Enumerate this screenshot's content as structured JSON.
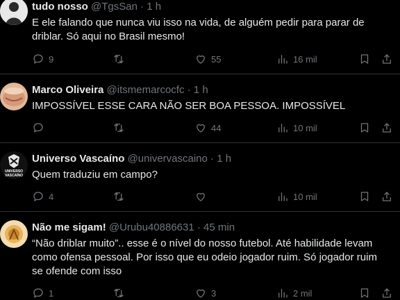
{
  "tweets": [
    {
      "name": "tudo nosso",
      "handle": "@TgsSan",
      "time": "1 h",
      "text": "E ele falando que nunca viu isso na vida, de alguém pedir para parar de driblar. Só aqui no Brasil mesmo!",
      "replies": "9",
      "retweets": "",
      "likes": "55",
      "views": "16 mil"
    },
    {
      "name": "Marco Oliveira",
      "handle": "@itsmemarcocfc",
      "time": "1 h",
      "text": "IMPOSSÍVEL ESSE CARA NÃO SER BOA PESSOA. IMPOSSÍVEL",
      "replies": "",
      "retweets": "",
      "likes": "44",
      "views": "10 mil"
    },
    {
      "name": "Universo Vascaíno",
      "handle": "@univervascaino",
      "time": "1 h",
      "text": "Quem traduziu em campo?",
      "replies": "4",
      "retweets": "",
      "likes": "",
      "views": "10 mil",
      "avatar_text": "UNIVERSO VASCAÍNO"
    },
    {
      "name": "Não me sigam!",
      "handle": "@Urubu40886631",
      "time": "45 min",
      "text": "“Não driblar muito”.. esse é o nível do nosso futebol. Até habilidade levam como ofensa pessoal. Por isso que eu odeio jogador ruim. Só jogador ruim se ofende com isso",
      "replies": "1",
      "retweets": "",
      "likes": "3",
      "views": "2 mil"
    }
  ],
  "separator": "·",
  "icons": [
    "reply-icon",
    "retweet-icon",
    "like-icon",
    "views-icon",
    "bookmark-icon",
    "share-icon"
  ],
  "colors": {
    "background": "#000000",
    "text": "#e7e9ea",
    "muted": "#71767b",
    "divider": "#2f3336"
  }
}
